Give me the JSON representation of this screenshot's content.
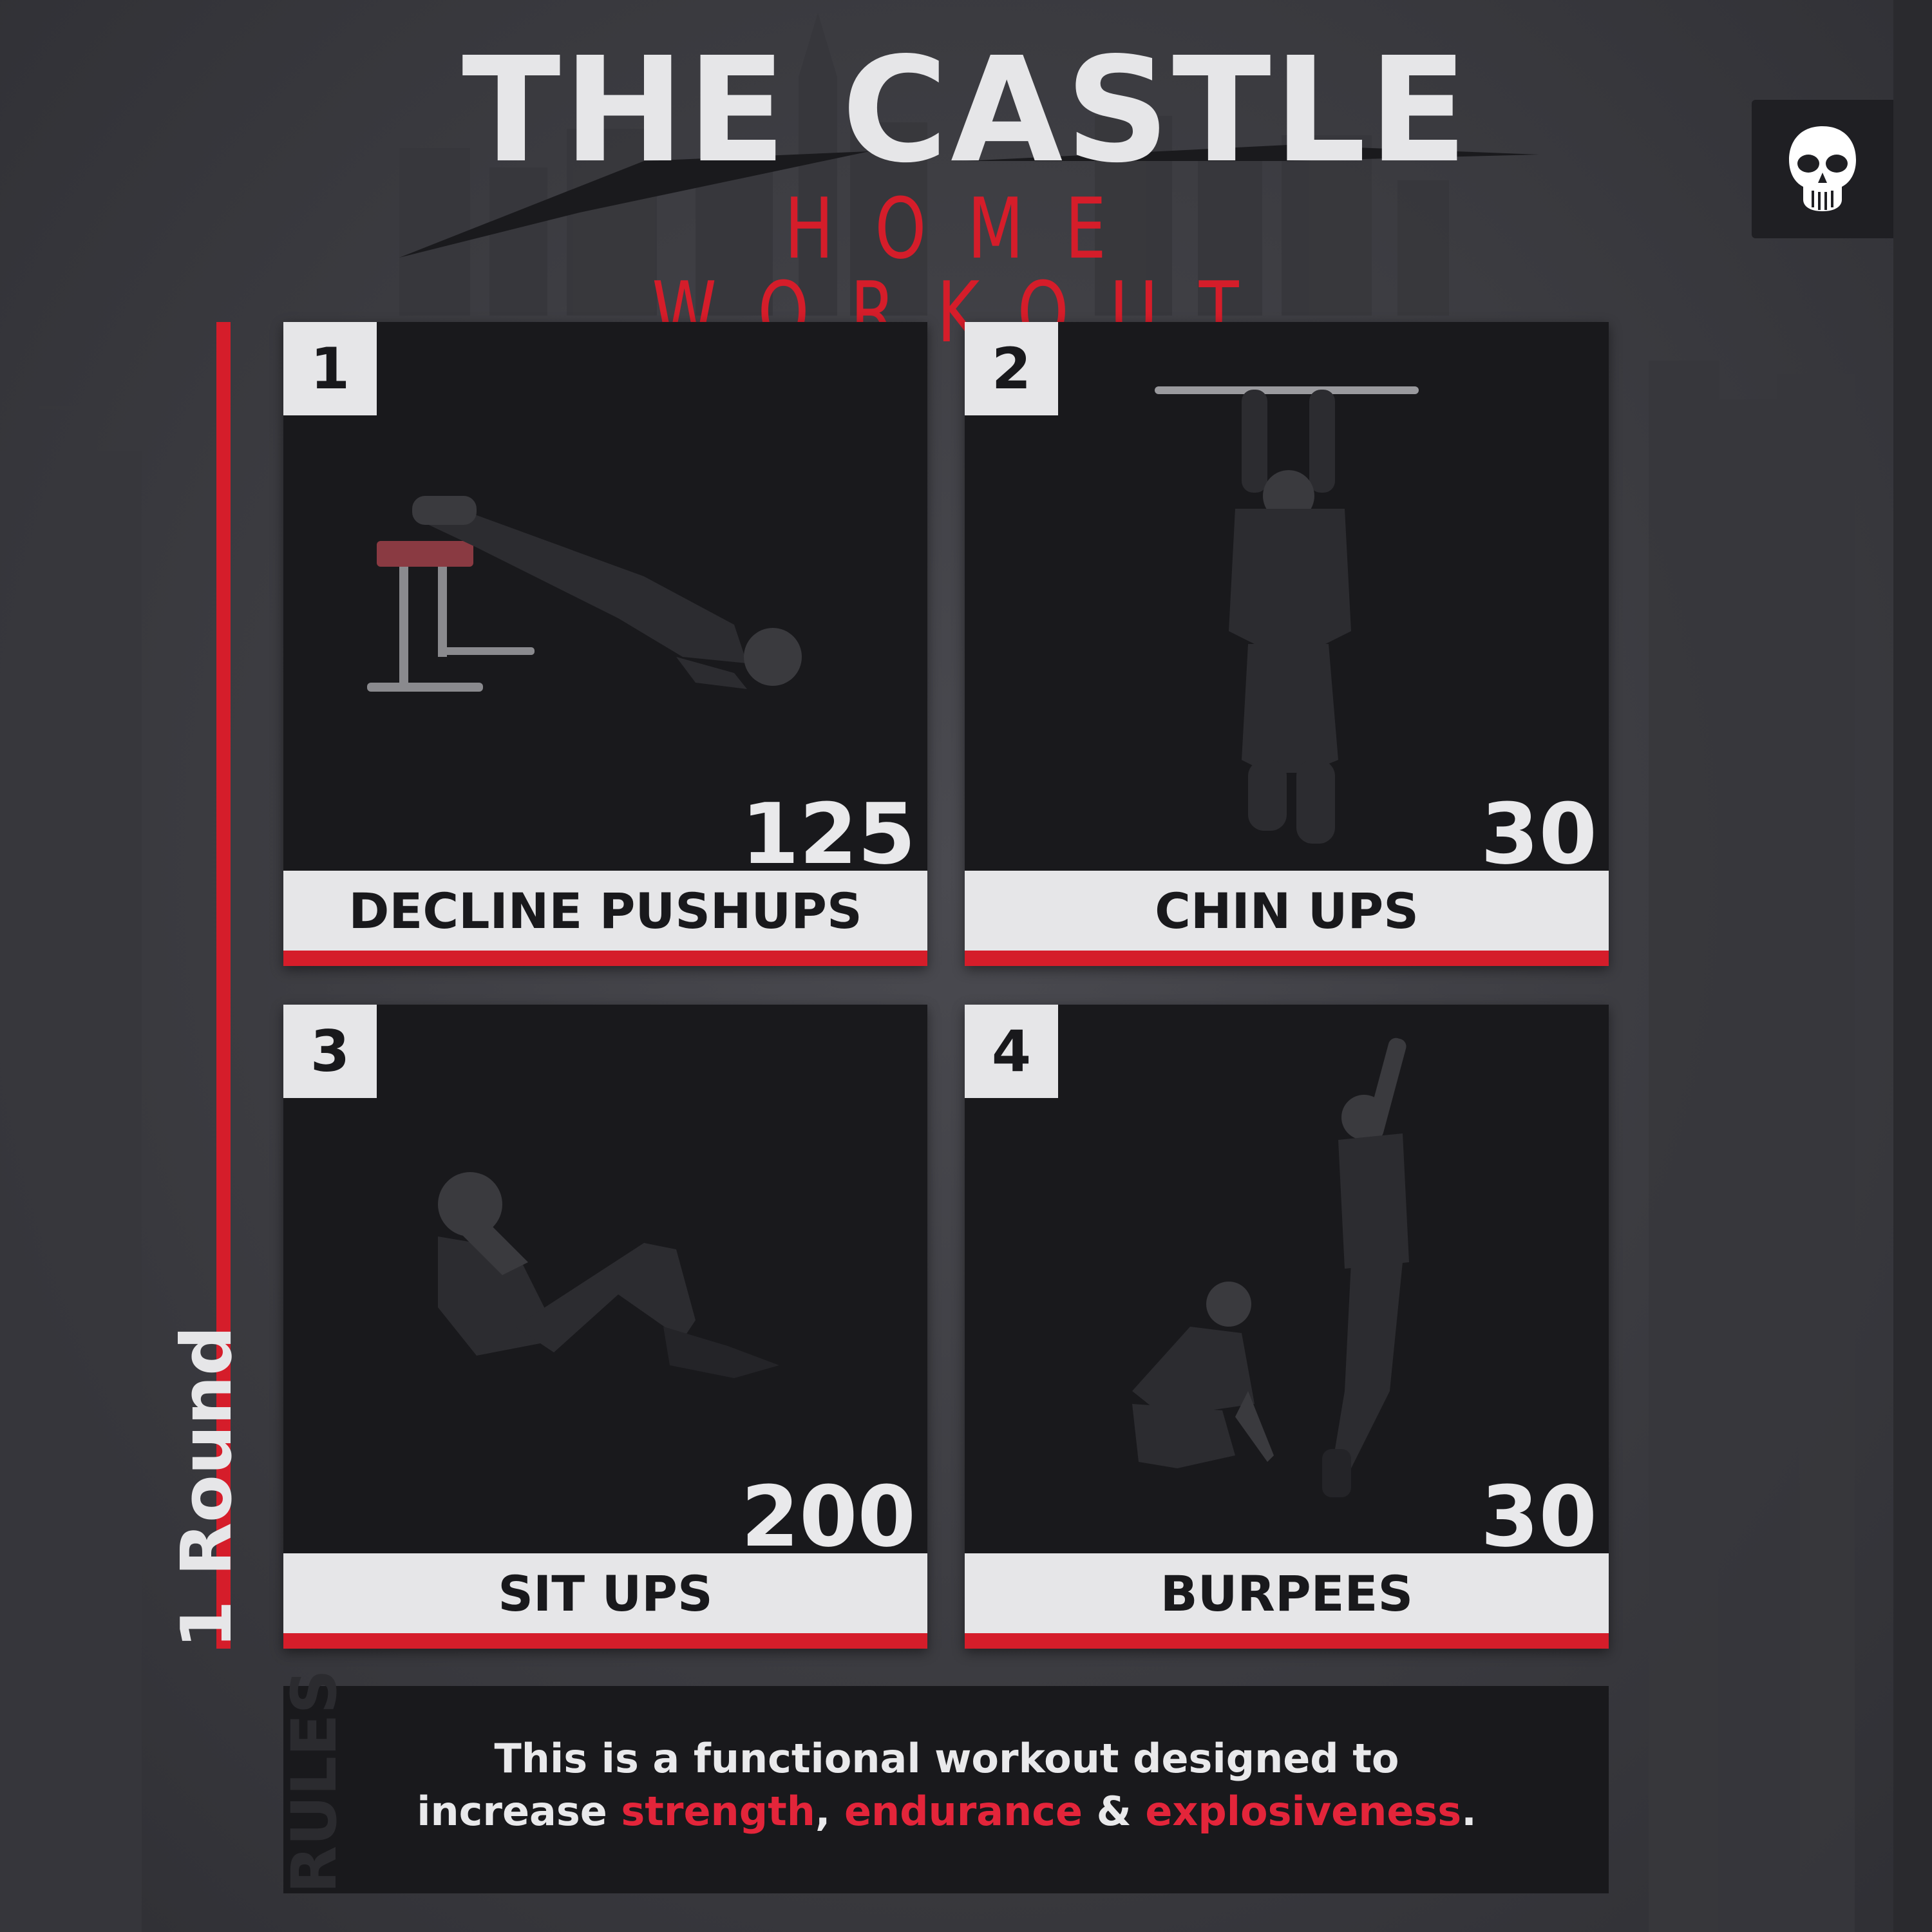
{
  "header": {
    "title": "THE CASTLE",
    "subtitle": "HOME WORKOUT"
  },
  "round_label": "1 Round",
  "exercises": [
    {
      "number": "1",
      "name": "DECLINE PUSHUPS",
      "reps": "125"
    },
    {
      "number": "2",
      "name": "CHIN UPS",
      "reps": "30"
    },
    {
      "number": "3",
      "name": "SIT UPS",
      "reps": "200"
    },
    {
      "number": "4",
      "name": "BURPEES",
      "reps": "30"
    }
  ],
  "rules": {
    "label": "RULES",
    "line1": "This is a functional workout designed to",
    "line2_prefix": "increase ",
    "word1": "strength",
    "sep1": ", ",
    "word2": "endurance",
    "sep2": " & ",
    "word3": "explosiveness",
    "suffix": "."
  },
  "colors": {
    "accent": "#d51d2a",
    "card": "#19191c",
    "label": "#e6e6e8"
  },
  "icons": {
    "brand": "skull-icon"
  }
}
